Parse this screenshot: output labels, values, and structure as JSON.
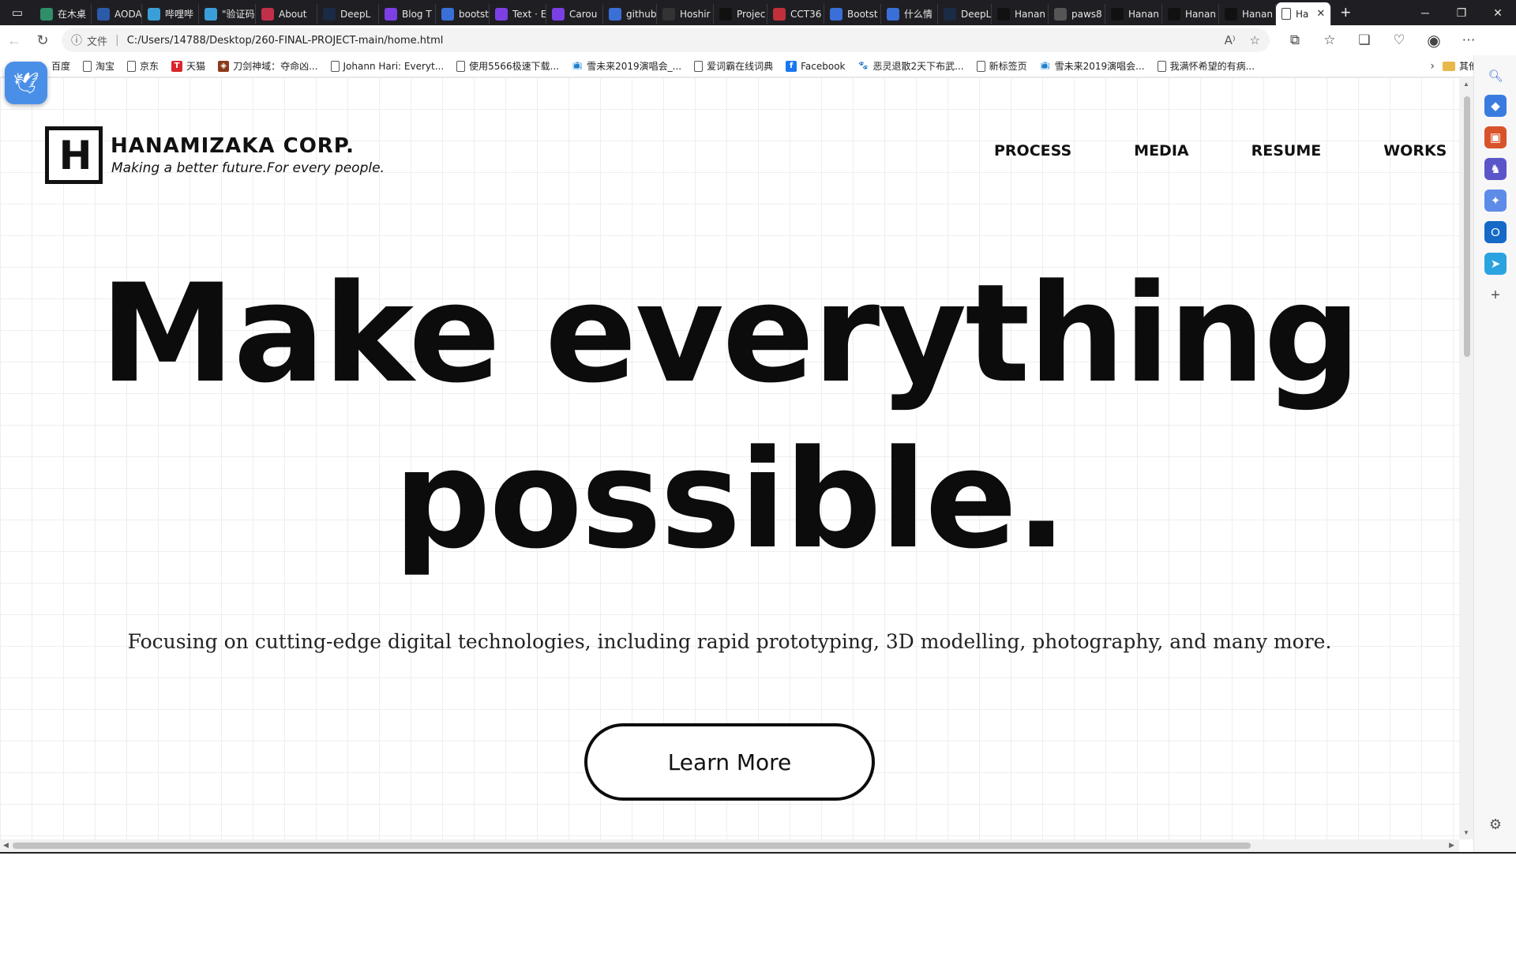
{
  "browser": {
    "tabs": [
      {
        "label": "在木桌",
        "color": "#2f8f6a"
      },
      {
        "label": "AODA",
        "color": "#2b5aa8"
      },
      {
        "label": "哔哩哔",
        "color": "#3a9fd8"
      },
      {
        "label": "\"验证码",
        "color": "#3a9fd8"
      },
      {
        "label": "About",
        "color": "#c0304a"
      },
      {
        "label": "DeepL",
        "color": "#1b2a45"
      },
      {
        "label": "Blog T",
        "color": "#7b3fe4"
      },
      {
        "label": "bootst",
        "color": "#3a6fd8"
      },
      {
        "label": "Text · E",
        "color": "#7b3fe4"
      },
      {
        "label": "Carou",
        "color": "#7b3fe4"
      },
      {
        "label": "github",
        "color": "#3a6fd8"
      },
      {
        "label": "Hoshir",
        "color": "#333333"
      },
      {
        "label": "Projec",
        "color": "#111111"
      },
      {
        "label": "CCT36",
        "color": "#c0303a"
      },
      {
        "label": "Bootst",
        "color": "#3a6fd8"
      },
      {
        "label": "什么情",
        "color": "#3a6fd8"
      },
      {
        "label": "DeepL",
        "color": "#1b2a45"
      },
      {
        "label": "Hanan",
        "color": "#111111"
      },
      {
        "label": "paws8",
        "color": "#555555"
      },
      {
        "label": "Hanan",
        "color": "#111111"
      },
      {
        "label": "Hanan",
        "color": "#111111"
      },
      {
        "label": "Hanan",
        "color": "#111111"
      }
    ],
    "active_tab": {
      "label": "Ha"
    },
    "address": {
      "scheme": "文件",
      "url": "C:/Users/14788/Desktop/260-FINAL-PROJECT-main/home.html"
    },
    "bookmarks": [
      {
        "label": "百度",
        "icon": "paw-icon"
      },
      {
        "label": "淘宝",
        "icon": "page-icon"
      },
      {
        "label": "京东",
        "icon": "page-icon"
      },
      {
        "label": "天猫",
        "icon": "tmall-icon"
      },
      {
        "label": "刀剑神域：夺命凶...",
        "icon": "game-icon"
      },
      {
        "label": "Johann Hari: Everyt...",
        "icon": "page-icon"
      },
      {
        "label": "使用5566极速下载...",
        "icon": "page-icon"
      },
      {
        "label": "雪未来2019演唱会_...",
        "icon": "bilibili-icon"
      },
      {
        "label": "爱词霸在线词典",
        "icon": "page-icon"
      },
      {
        "label": "Facebook",
        "icon": "facebook-icon"
      },
      {
        "label": "恶灵退散2天下布武...",
        "icon": "paw-icon"
      },
      {
        "label": "新标签页",
        "icon": "page-icon"
      },
      {
        "label": "雪未来2019演唱会...",
        "icon": "bilibili-icon"
      },
      {
        "label": "我满怀希望的有病...",
        "icon": "page-icon"
      }
    ],
    "other_bookmarks": "其他收藏夹"
  },
  "site": {
    "logo_letter": "H",
    "brand_name": "HANAMIZAKA CORP.",
    "tagline": "Making a better future.For every people.",
    "nav": [
      "PROCESS",
      "MEDIA",
      "RESUME",
      "WORKS"
    ],
    "hero_line1": "Make everything",
    "hero_line2": "possible.",
    "subtitle": "Focusing on cutting-edge digital technologies, including rapid prototyping, 3D modelling, photography, and many more.",
    "cta_label": "Learn More"
  },
  "colors": {
    "tabbar_bg": "#1f1f23",
    "grid_line": "#eeeeee",
    "text_dark": "#0c0c0c"
  }
}
